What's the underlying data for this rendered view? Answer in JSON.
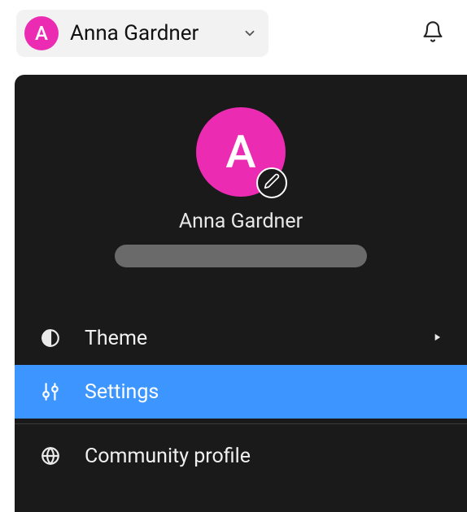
{
  "colors": {
    "accent_pink": "#ec2bb3",
    "highlight_blue": "#3d95ff",
    "panel_bg": "#1a1a1a"
  },
  "header": {
    "user_name": "Anna Gardner",
    "avatar_initial": "A"
  },
  "dropdown": {
    "profile": {
      "avatar_initial": "A",
      "display_name": "Anna Gardner"
    },
    "menu": [
      {
        "id": "theme",
        "label": "Theme",
        "icon": "contrast-icon",
        "has_submenu": true,
        "highlighted": false
      },
      {
        "id": "settings",
        "label": "Settings",
        "icon": "sliders-icon",
        "has_submenu": false,
        "highlighted": true
      },
      {
        "id": "community",
        "label": "Community profile",
        "icon": "globe-icon",
        "has_submenu": false,
        "highlighted": false
      }
    ]
  }
}
